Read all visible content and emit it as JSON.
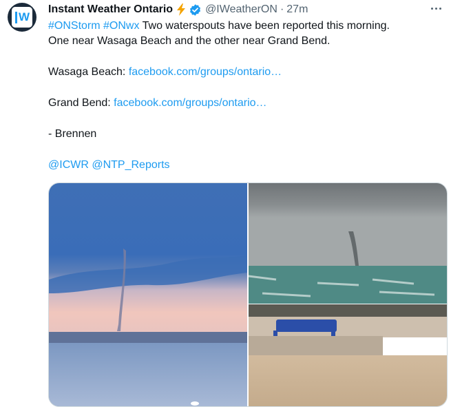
{
  "account": {
    "name": "Instant Weather Ontario",
    "handle": "@IWeatherON",
    "separator": "·",
    "time": "27m",
    "avatar_text": "W",
    "verified_color": "#1d9bf0"
  },
  "tweet": {
    "hashtag1": "#ONStorm",
    "hashtag2": "#ONwx",
    "intro": " Two waterspouts have been reported this morning.",
    "intro_line2": "One near Wasaga Beach and the other near Grand Bend.",
    "wasaga_label": "Wasaga Beach: ",
    "wasaga_link": "facebook.com/groups/ontario…",
    "grandbend_label": "Grand Bend: ",
    "grandbend_link": "facebook.com/groups/ontario…",
    "signature": "- Brennen",
    "mention1": "@ICWR",
    "mention2": "@NTP_Reports"
  },
  "media": {
    "images": [
      "waterspout-wasaga-beach",
      "waterspout-grand-bend"
    ]
  },
  "colors": {
    "link": "#1d9bf0",
    "secondary_text": "#536471",
    "primary_text": "#0f1419"
  }
}
